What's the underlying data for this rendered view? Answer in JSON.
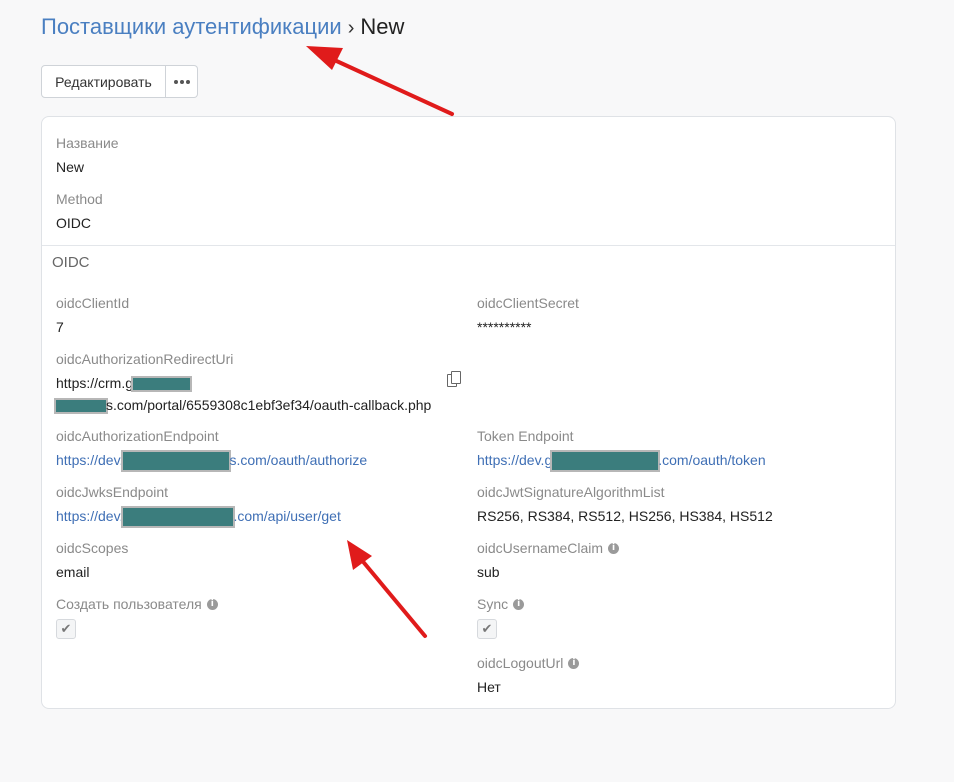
{
  "breadcrumb": {
    "parent": "Поставщики аутентификации",
    "separator": "›",
    "current": "New"
  },
  "toolbar": {
    "edit_label": "Редактировать"
  },
  "general": {
    "name_label": "Название",
    "name_value": "New",
    "method_label": "Method",
    "method_value": "OIDC"
  },
  "oidc": {
    "section_title": "OIDC",
    "client_id_label": "oidcClientId",
    "client_id_value": "7",
    "client_secret_label": "oidcClientSecret",
    "client_secret_value": "**********",
    "redirect_label": "oidcAuthorizationRedirectUri",
    "redirect_value_line1": "https://crm.g",
    "redirect_value_line2": "s.com/portal/6559308c1ebf3ef34/oauth-callback.php",
    "auth_endpoint_label": "oidcAuthorizationEndpoint",
    "auth_endpoint_prefix": "https://dev.",
    "auth_endpoint_suffix": "s.com/oauth/authorize",
    "token_endpoint_label": "Token Endpoint",
    "token_endpoint_prefix": "https://dev.g",
    "token_endpoint_suffix": ".com/oauth/token",
    "jwks_label": "oidcJwksEndpoint",
    "jwks_prefix": "https://dev.",
    "jwks_suffix": ".com/api/user/get",
    "jwt_alg_label": "oidcJwtSignatureAlgorithmList",
    "jwt_alg_value": "RS256, RS384, RS512, HS256, HS384, HS512",
    "scopes_label": "oidcScopes",
    "scopes_value": "email",
    "username_claim_label": "oidcUsernameClaim",
    "username_claim_value": "sub",
    "create_user_label": "Создать пользователя",
    "create_user_checked": true,
    "sync_label": "Sync",
    "sync_checked": true,
    "logout_label": "oidcLogoutUrl",
    "logout_value": "Нет"
  },
  "icons": {
    "info": "info-icon",
    "copy": "copy-icon",
    "check": "check-icon",
    "more": "more-dots-icon"
  },
  "colors": {
    "link": "#3f6fb5",
    "breadcrumb_link": "#4a7fc1",
    "annotation_arrow": "#e01b1b",
    "redaction": "#3b7d7d"
  }
}
